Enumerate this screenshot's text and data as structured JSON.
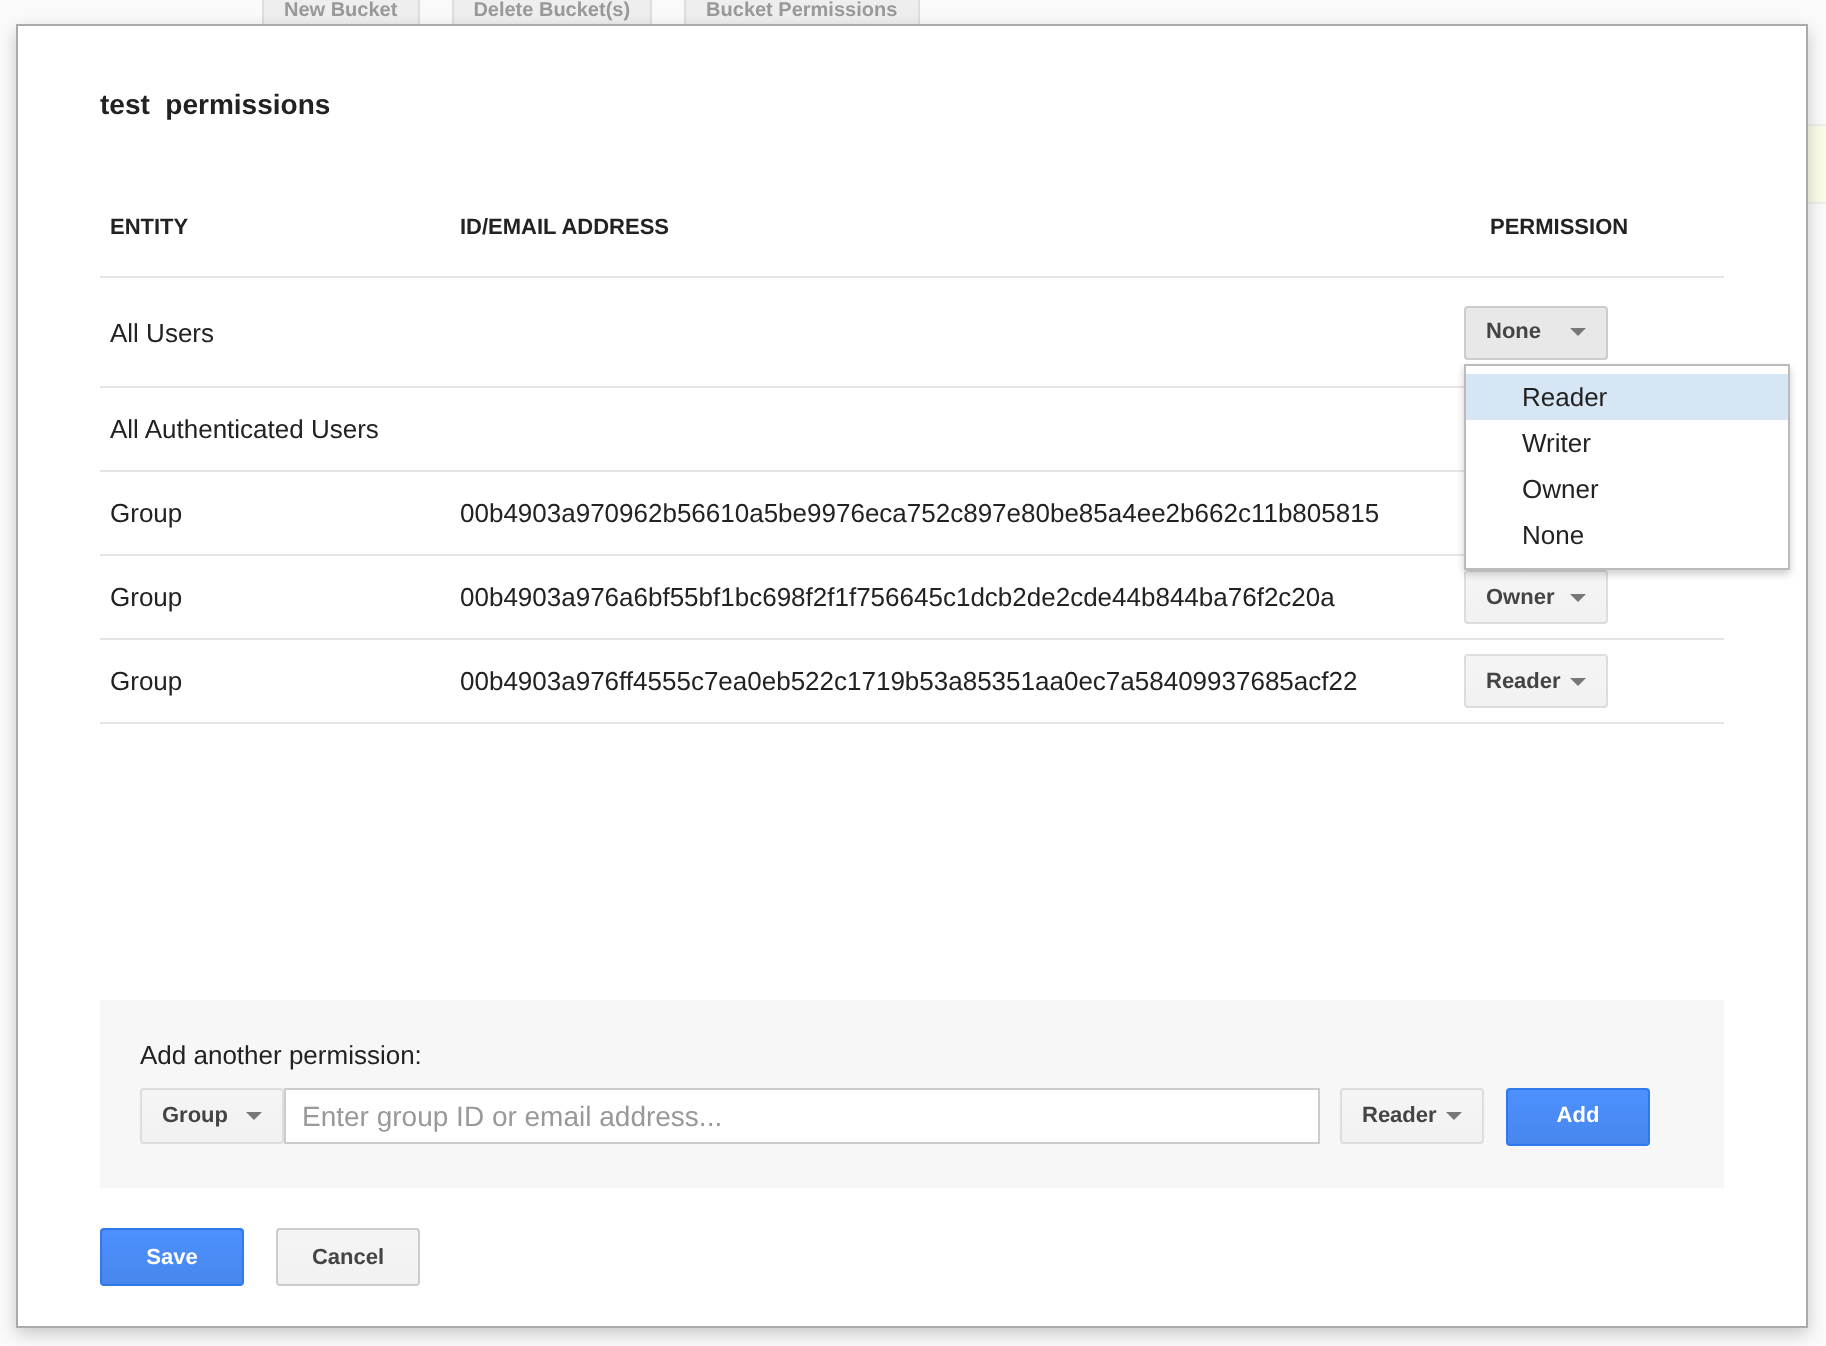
{
  "background": {
    "toolbar_buttons": [
      "New Bucket",
      "Delete Bucket(s)",
      "Bucket Permissions"
    ]
  },
  "dialog": {
    "title": "test  permissions",
    "table": {
      "columns": [
        "ENTITY",
        "ID/EMAIL ADDRESS",
        "PERMISSION"
      ],
      "rows": [
        {
          "entity": "All Users",
          "permission": {
            "value": "None",
            "expanded": true,
            "options": [
              {
                "label": "Reader",
                "highlighted": true
              },
              {
                "label": "Writer",
                "highlighted": false
              },
              {
                "label": "Owner",
                "highlighted": false
              },
              {
                "label": "None",
                "highlighted": false
              }
            ]
          }
        },
        {
          "entity": "All Authenticated Users"
        },
        {
          "entity": "Group",
          "id": "00b4903a970962b56610a5be9976eca752c897e80be85a4ee2b662c11b805815"
        },
        {
          "entity": "Group",
          "id": "00b4903a976a6bf55bf1bc698f2f1f756645c1dcb2de2cde44b844ba76f2c20a",
          "permission": {
            "value": "Owner",
            "expanded": false
          }
        },
        {
          "entity": "Group",
          "id": "00b4903a976ff4555c7ea0eb522c1719b53a85351aa0ec7a58409937685acf22",
          "permission": {
            "value": "Reader",
            "expanded": false
          }
        }
      ]
    },
    "add_panel": {
      "label": "Add another permission:",
      "entity_type": "Group",
      "input": {
        "placeholder": "Enter group ID or email address..."
      },
      "permission": "Reader",
      "add_button": "Add"
    },
    "buttons": [
      {
        "label": "Save",
        "kind": "primary"
      },
      {
        "label": "Cancel",
        "kind": "secondary"
      }
    ]
  }
}
